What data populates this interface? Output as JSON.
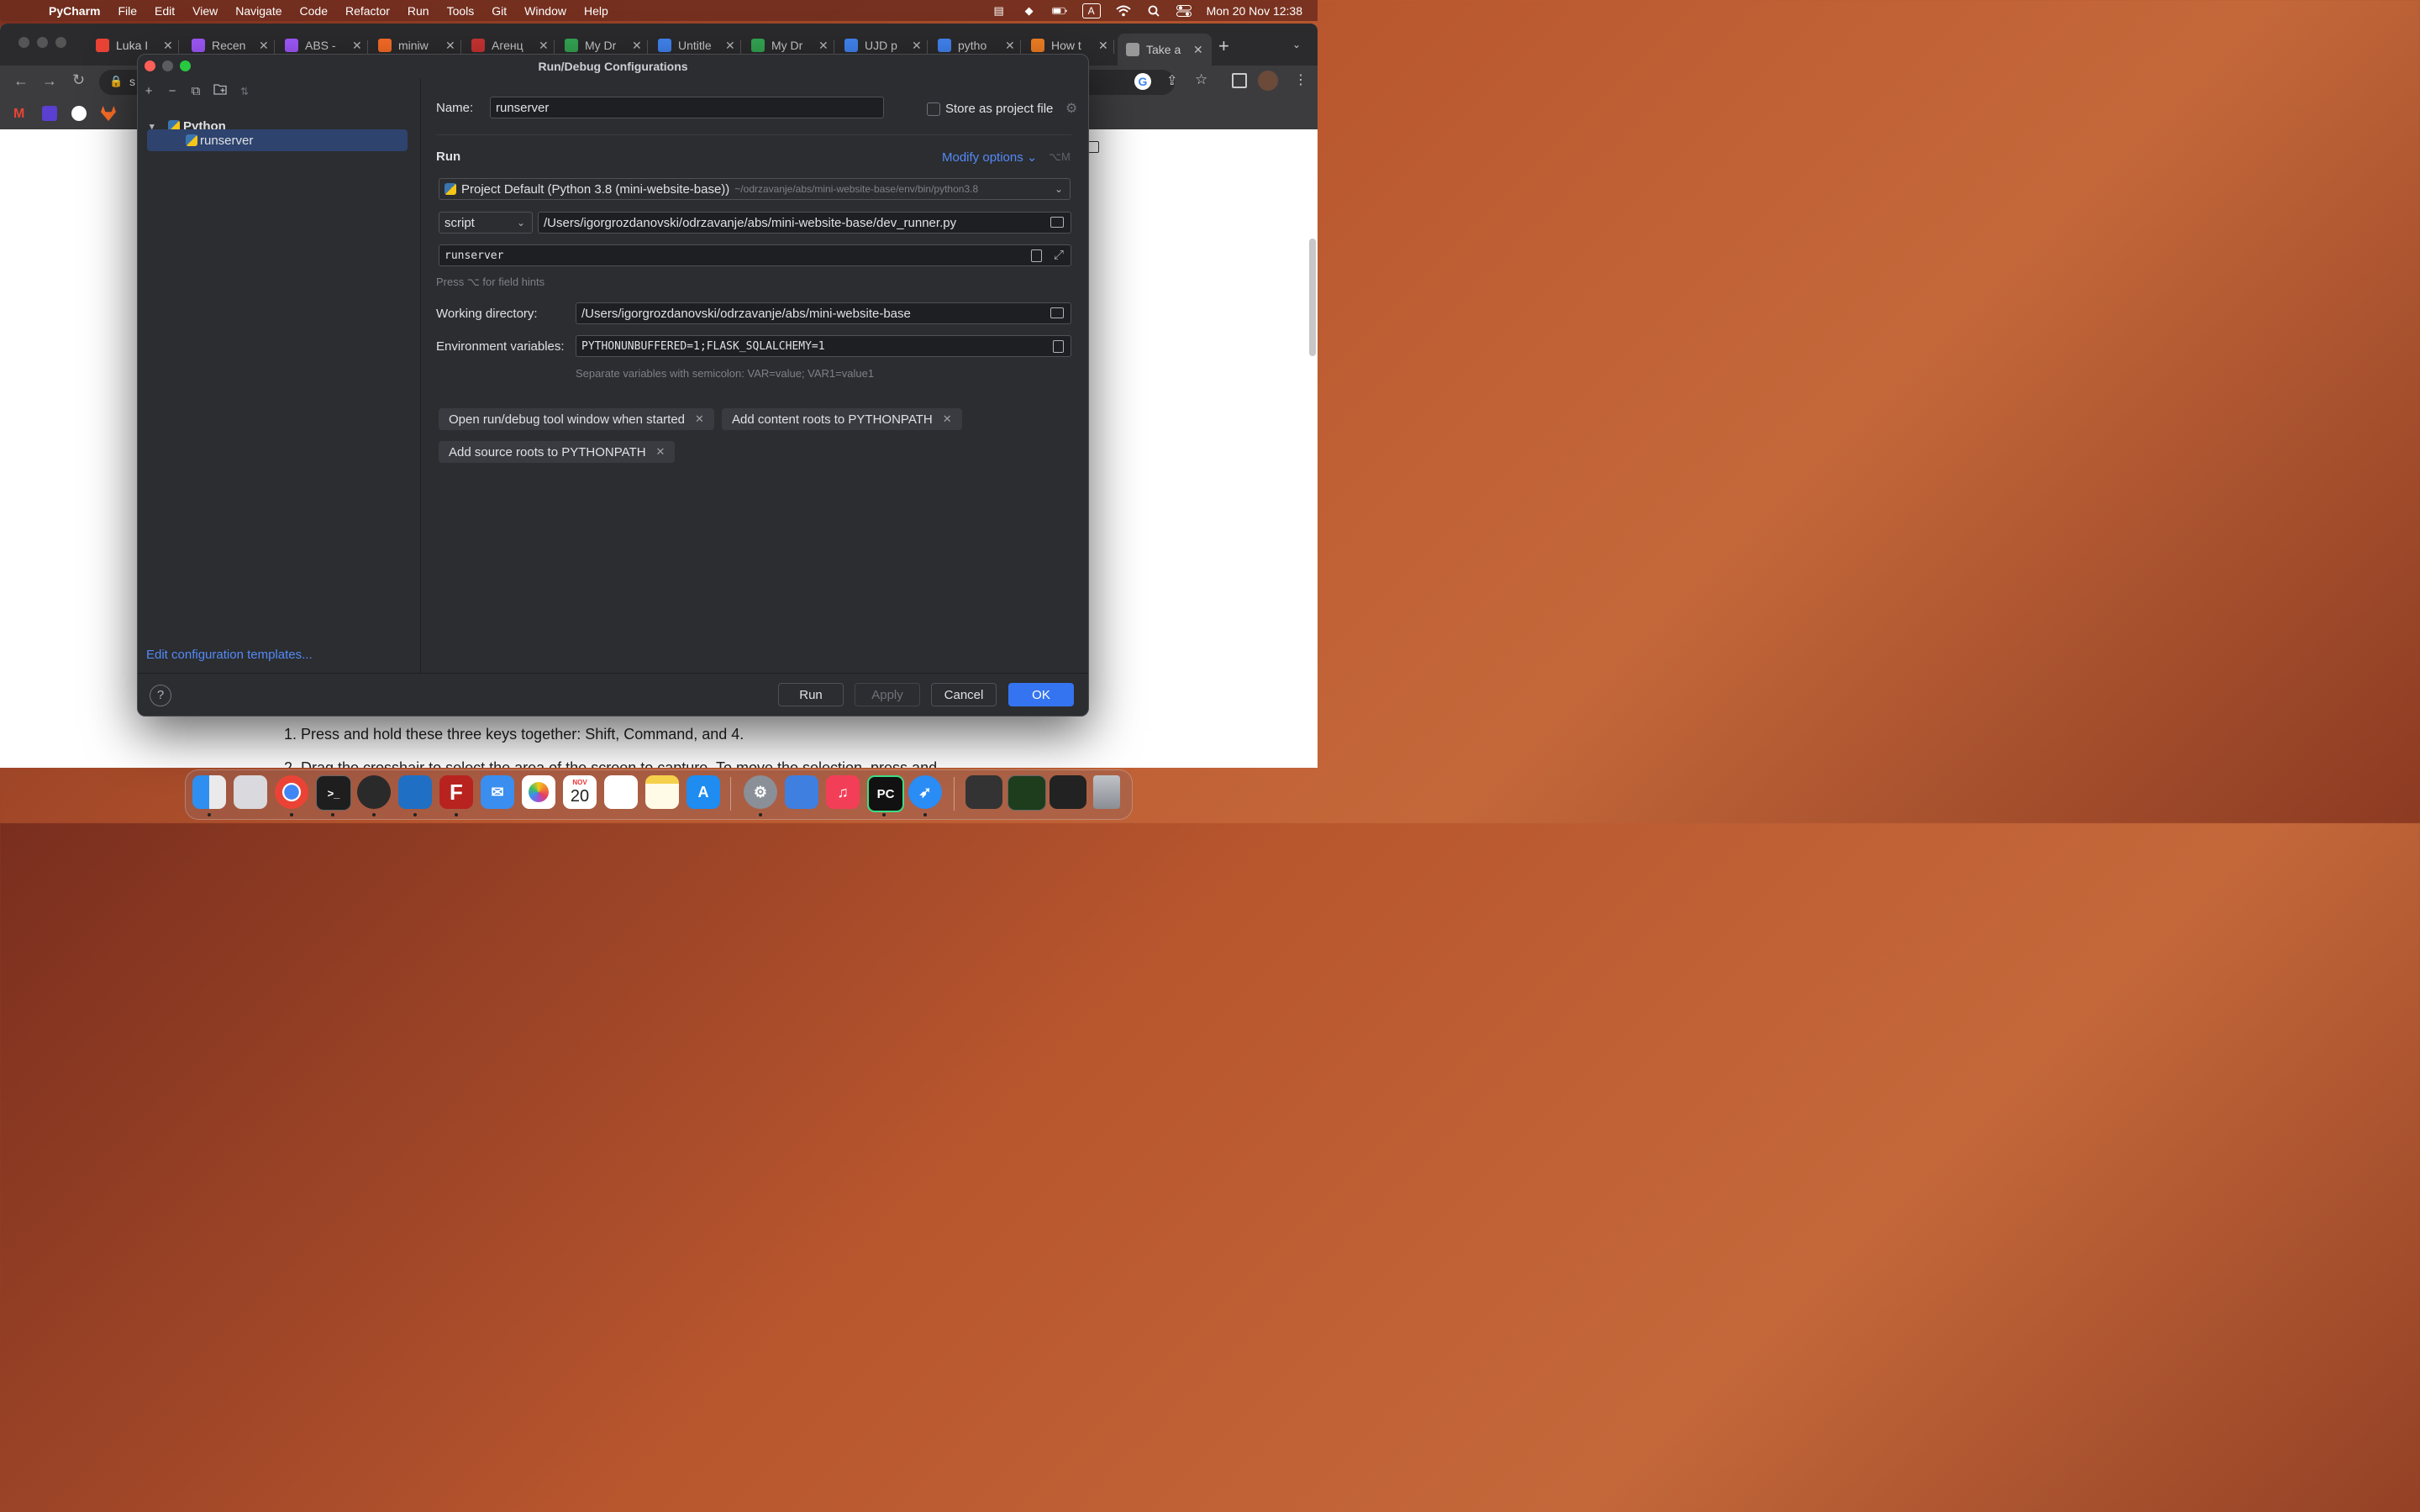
{
  "menubar": {
    "app": "PyCharm",
    "items": [
      "File",
      "Edit",
      "View",
      "Navigate",
      "Code",
      "Refactor",
      "Run",
      "Tools",
      "Git",
      "Window",
      "Help"
    ],
    "clock": "Mon 20 Nov  12:38",
    "input_indicator": "A"
  },
  "browser": {
    "tabs": [
      {
        "label": "Luka I",
        "color": "#ea4335"
      },
      {
        "label": "Recen",
        "color": "#a259ff"
      },
      {
        "label": "ABS -",
        "color": "#a259ff"
      },
      {
        "label": "miniw",
        "color": "#fc6d26"
      },
      {
        "label": "Агенц",
        "color": "#cc3333"
      },
      {
        "label": "My Dr",
        "color": "#34a853"
      },
      {
        "label": "Untitle",
        "color": "#4285f4"
      },
      {
        "label": "My Dr",
        "color": "#34a853"
      },
      {
        "label": "UJD p",
        "color": "#4285f4"
      },
      {
        "label": "pytho",
        "color": "#4285f4"
      },
      {
        "label": "How t",
        "color": "#f48024"
      },
      {
        "label": "Take a",
        "color": "#999999"
      }
    ],
    "address_prefix": "s",
    "page_line1": "1. Press and hold these three keys together: Shift, Command, and 4.",
    "page_line2": "2. Drag the crosshair  to select the area of the screen to capture. To move the selection, press and"
  },
  "dialog": {
    "title": "Run/Debug Configurations",
    "tree_root": "Python",
    "tree_item": "runserver",
    "edit_templates": "Edit configuration templates...",
    "name_label": "Name:",
    "name_value": "runserver",
    "store_label": "Store as project file",
    "store_checked": false,
    "run_heading": "Run",
    "modify_options": "Modify options",
    "modify_shortcut": "⌥M",
    "interpreter_main": "Project Default (Python 3.8 (mini-website-base))",
    "interpreter_path": "~/odrzavanje/abs/mini-website-base/env/bin/python3.8",
    "run_type": "script",
    "script_path": "/Users/igorgrozdanovski/odrzavanje/abs/mini-website-base/dev_runner.py",
    "parameters": "runserver",
    "field_hint": "Press ⌥ for field hints",
    "workdir_label": "Working directory:",
    "workdir_value": "/Users/igorgrozdanovski/odrzavanje/abs/mini-website-base",
    "env_label": "Environment variables:",
    "env_value": "PYTHONUNBUFFERED=1;FLASK_SQLALCHEMY=1",
    "env_hint": "Separate variables with semicolon: VAR=value; VAR1=value1",
    "chips": [
      "Open run/debug tool window when started",
      "Add content roots to PYTHONPATH",
      "Add source roots to PYTHONPATH"
    ],
    "buttons": {
      "run": "Run",
      "apply": "Apply",
      "cancel": "Cancel",
      "ok": "OK"
    }
  },
  "dock": {
    "calendar_month": "NOV",
    "calendar_day": "20"
  }
}
